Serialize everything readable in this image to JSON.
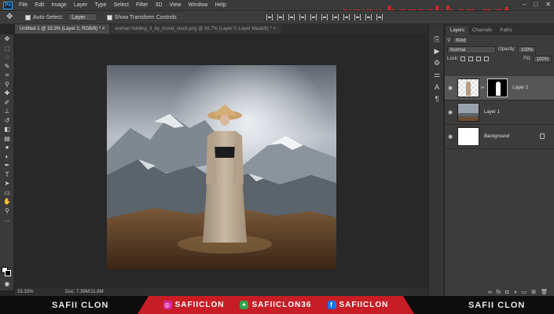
{
  "menu": {
    "app_icon": "Ps",
    "items": [
      "File",
      "Edit",
      "Image",
      "Layer",
      "Type",
      "Select",
      "Filter",
      "3D",
      "View",
      "Window",
      "Help"
    ]
  },
  "watermark": "www.hareskhan.net",
  "options": {
    "auto_select_label": "Auto-Select:",
    "auto_select_value": "Layer",
    "transform_label": "Show Transform Controls"
  },
  "tabs": [
    {
      "label": "Untitled-1 @ 33.3% (Layer 2, RGB/8) *",
      "active": true
    },
    {
      "label": "woman holding_3_by_mood_stock.png @ 16.7% (Layer 0, Layer Mask/8) *",
      "active": false
    }
  ],
  "status": {
    "zoom": "33.33%",
    "doc": "Doc: 7.39M/11.8M"
  },
  "panel": {
    "tabs": [
      "Layers",
      "Channels",
      "Paths"
    ],
    "kind_label": "Kind",
    "blend_mode": "Normal",
    "opacity_label": "Opacity:",
    "opacity_value": "100%",
    "lock_label": "Lock:",
    "fill_label": "Fill:",
    "fill_value": "100%",
    "layers": [
      {
        "name": "Layer 2",
        "selected": true
      },
      {
        "name": "Layer 1",
        "selected": false
      },
      {
        "name": "Background",
        "selected": false
      }
    ]
  },
  "branding": {
    "left": "SAFII CLON",
    "instagram": "SAFIICLON",
    "stack": "SAFIICLON36",
    "facebook": "SAFIICLON",
    "right": "SAFII CLON"
  },
  "colors": {
    "accent_red": "#c81d25",
    "instagram": "#d6249f",
    "stack": "#2ea44f",
    "facebook": "#1877f2"
  }
}
